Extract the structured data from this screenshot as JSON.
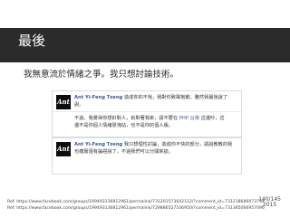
{
  "slide": {
    "title": "最後",
    "subtitle": "我無意流於情緒之爭。我只想討論技術。"
  },
  "cards": [
    {
      "logo_text": "Ant",
      "comment1_name": "Ant Yi-Feng Tzeng",
      "comment1_text_a": "造成你的不悅，我對你致聲抱歉。雖然我最後說了",
      "comment1_text_b": "說。",
      "reply_text_a": "不過，我覺得你想針對人，就對著我來，請不要在",
      "reply_highlight": "PHP 台灣",
      "reply_text_b": "這邊吵，這",
      "reply_text_c": "邊不是你個人情緒發洩站，也不是你的個人版。"
    },
    {
      "logo_text": "Ant",
      "comment_name": "Ant Yi-Feng Tzeng",
      "comment_text_a": "我只想理性討論，造成你不快的部分，請說教教的我",
      "comment_text_b": "也確實還有論證說了，不過我們可以分開來談。"
    }
  ],
  "footer": {
    "ref1": "Ref: https://www.facebook.com/groups/199493136812961/permalink/731201573642112/?comment_id=731218686973734",
    "ref2": "Ref: https://www.facebook.com/groups/199493136812961/permalink/729886527106950/?comment_id=731385066957096",
    "page": "140/145",
    "year": "2015"
  }
}
